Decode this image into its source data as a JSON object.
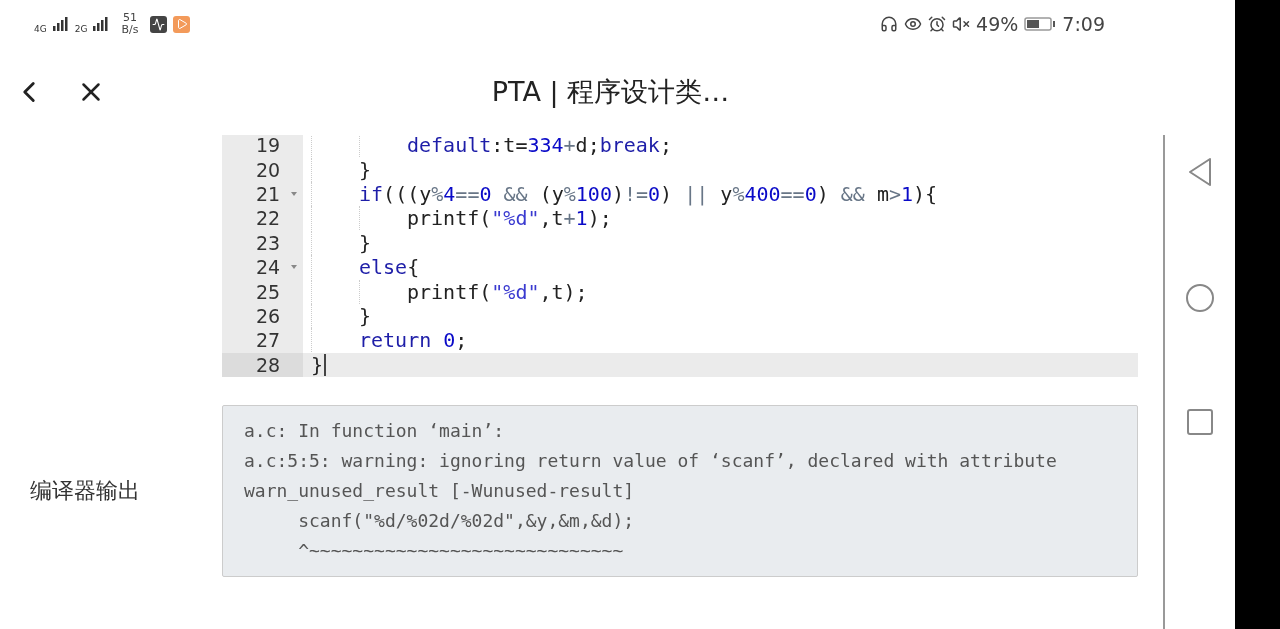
{
  "status_bar": {
    "network_1": "4G",
    "network_2": "2G",
    "speed_value": "51",
    "speed_unit": "B/s",
    "battery": "49%",
    "time": "7:09"
  },
  "header": {
    "title": "PTA | 程序设计类…"
  },
  "code": {
    "lines": [
      {
        "number": "19",
        "foldable": false,
        "active": false,
        "tokens": [
          {
            "kind": "guide"
          },
          {
            "kind": "guide"
          },
          {
            "kind": "keyword",
            "text": "default"
          },
          {
            "kind": "plain",
            "text": ":t="
          },
          {
            "kind": "number",
            "text": "334"
          },
          {
            "kind": "operator",
            "text": "+"
          },
          {
            "kind": "plain",
            "text": "d;"
          },
          {
            "kind": "keyword",
            "text": "break"
          },
          {
            "kind": "plain",
            "text": ";"
          }
        ]
      },
      {
        "number": "20",
        "foldable": false,
        "active": false,
        "tokens": [
          {
            "kind": "guide"
          },
          {
            "kind": "plain",
            "text": "}"
          }
        ]
      },
      {
        "number": "21",
        "foldable": true,
        "active": false,
        "tokens": [
          {
            "kind": "guide"
          },
          {
            "kind": "keyword",
            "text": "if"
          },
          {
            "kind": "plain",
            "text": "(((y"
          },
          {
            "kind": "operator",
            "text": "%"
          },
          {
            "kind": "number",
            "text": "4"
          },
          {
            "kind": "operator",
            "text": "=="
          },
          {
            "kind": "number",
            "text": "0"
          },
          {
            "kind": "operator",
            "text": " &&"
          },
          {
            "kind": "plain",
            "text": " (y"
          },
          {
            "kind": "operator",
            "text": "%"
          },
          {
            "kind": "number",
            "text": "100"
          },
          {
            "kind": "plain",
            "text": ")"
          },
          {
            "kind": "operator",
            "text": "!="
          },
          {
            "kind": "number",
            "text": "0"
          },
          {
            "kind": "plain",
            "text": ") "
          },
          {
            "kind": "operator",
            "text": "||"
          },
          {
            "kind": "plain",
            "text": " y"
          },
          {
            "kind": "operator",
            "text": "%"
          },
          {
            "kind": "number",
            "text": "400"
          },
          {
            "kind": "operator",
            "text": "=="
          },
          {
            "kind": "number",
            "text": "0"
          },
          {
            "kind": "plain",
            "text": ") "
          },
          {
            "kind": "operator",
            "text": "&&"
          },
          {
            "kind": "plain",
            "text": " m"
          },
          {
            "kind": "operator",
            "text": ">"
          },
          {
            "kind": "number",
            "text": "1"
          },
          {
            "kind": "plain",
            "text": "){"
          }
        ]
      },
      {
        "number": "22",
        "foldable": false,
        "active": false,
        "tokens": [
          {
            "kind": "guide"
          },
          {
            "kind": "guide"
          },
          {
            "kind": "plain",
            "text": "printf("
          },
          {
            "kind": "string",
            "text": "\"%d\""
          },
          {
            "kind": "plain",
            "text": ",t"
          },
          {
            "kind": "operator",
            "text": "+"
          },
          {
            "kind": "number",
            "text": "1"
          },
          {
            "kind": "plain",
            "text": ");"
          }
        ]
      },
      {
        "number": "23",
        "foldable": false,
        "active": false,
        "tokens": [
          {
            "kind": "guide"
          },
          {
            "kind": "plain",
            "text": "}"
          }
        ]
      },
      {
        "number": "24",
        "foldable": true,
        "active": false,
        "tokens": [
          {
            "kind": "guide"
          },
          {
            "kind": "keyword",
            "text": "else"
          },
          {
            "kind": "plain",
            "text": "{"
          }
        ]
      },
      {
        "number": "25",
        "foldable": false,
        "active": false,
        "tokens": [
          {
            "kind": "guide"
          },
          {
            "kind": "guide"
          },
          {
            "kind": "plain",
            "text": "printf("
          },
          {
            "kind": "string",
            "text": "\"%d\""
          },
          {
            "kind": "plain",
            "text": ",t);"
          }
        ]
      },
      {
        "number": "26",
        "foldable": false,
        "active": false,
        "tokens": [
          {
            "kind": "guide"
          },
          {
            "kind": "plain",
            "text": "}"
          }
        ]
      },
      {
        "number": "27",
        "foldable": false,
        "active": false,
        "tokens": [
          {
            "kind": "guide"
          },
          {
            "kind": "keyword",
            "text": "return "
          },
          {
            "kind": "number",
            "text": "0"
          },
          {
            "kind": "plain",
            "text": ";"
          }
        ]
      },
      {
        "number": "28",
        "foldable": false,
        "active": true,
        "tokens": [
          {
            "kind": "plain",
            "text": "}"
          }
        ]
      }
    ]
  },
  "compiler_output": {
    "label": "编译器输出",
    "lines": [
      "a.c: In function ‘main’:",
      "a.c:5:5: warning: ignoring return value of ‘scanf’, declared with attribute",
      "warn_unused_result [-Wunused-result]",
      "     scanf(\"%d/%02d/%02d\",&y,&m,&d);",
      "     ^~~~~~~~~~~~~~~~~~~~~~~~~~~~~~"
    ]
  }
}
